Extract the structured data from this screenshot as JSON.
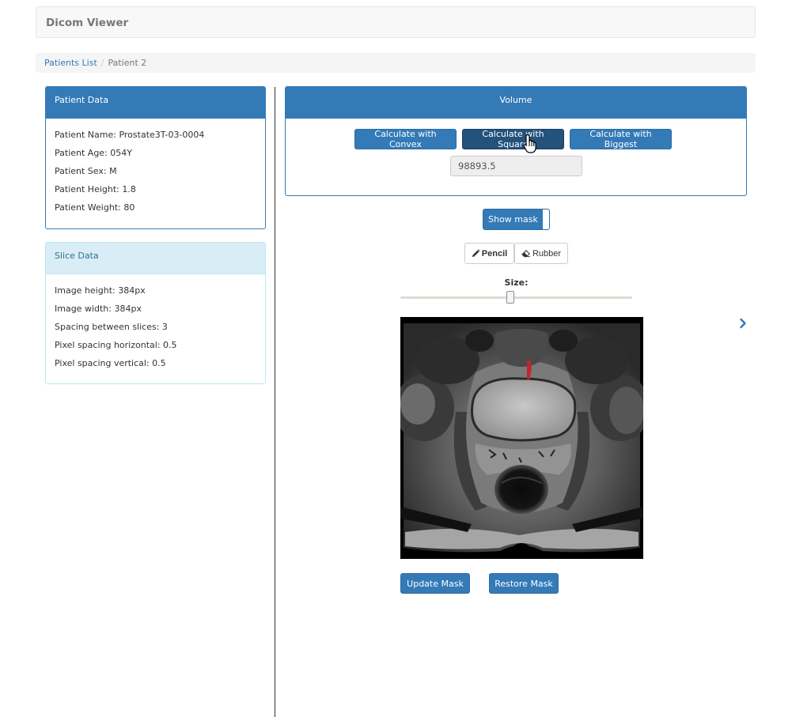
{
  "app": {
    "title": "Dicom Viewer"
  },
  "breadcrumb": {
    "items": [
      "Patients List",
      "Patient 2"
    ],
    "separator": "/"
  },
  "patient_panel": {
    "title": "Patient Data",
    "lines": [
      "Patient Name: Prostate3T-03-0004",
      "Patient Age: 054Y",
      "Patient Sex: M",
      "Patient Height: 1.8",
      "Patient Weight: 80"
    ]
  },
  "slice_panel": {
    "title": "Slice Data",
    "lines": [
      "Image height: 384px",
      "Image width: 384px",
      "Spacing between slices: 3",
      "Pixel spacing horizontal: 0.5",
      "Pixel spacing vertical: 0.5"
    ]
  },
  "volume_panel": {
    "title": "Volume",
    "buttons": [
      "Calculate with Convex",
      "Calculate with Square",
      "Calculate with Biggest"
    ],
    "active_button": "Calculate with Square",
    "value": "98893.5"
  },
  "mask_toggle": {
    "label": "Show mask",
    "state": "on"
  },
  "tools": {
    "pencil_label": "Pencil",
    "rubber_label": "Rubber",
    "selected": "Pencil"
  },
  "size_slider": {
    "label": "Size:",
    "value_fraction": 0.47
  },
  "actions": {
    "update_label": "Update Mask",
    "restore_label": "Restore Mask"
  },
  "icons": {
    "next": "chevron-right-icon",
    "pencil": "pencil-icon",
    "rubber": "eraser-icon"
  },
  "colors": {
    "primary": "#337ab7",
    "primary_active": "#23527c",
    "info_bg": "#d9edf7",
    "info_text": "#31708f",
    "mask": "#c0272d"
  }
}
